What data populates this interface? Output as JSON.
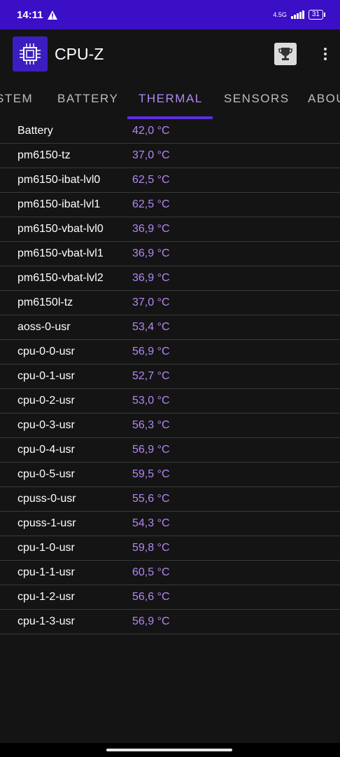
{
  "status_bar": {
    "time": "14:11",
    "alert_icon": "warning-triangle-icon",
    "network": "4.5G",
    "battery": "31"
  },
  "app_bar": {
    "title": "CPU-Z",
    "logo_icon": "cpu-chip-icon",
    "trophy_icon": "trophy-icon",
    "menu_icon": "more-vert-icon"
  },
  "tabs": [
    "STEM",
    "BATTERY",
    "THERMAL",
    "SENSORS",
    "ABOU"
  ],
  "active_tab": "THERMAL",
  "thermal": [
    {
      "name": "Battery",
      "value": "42,0 °C"
    },
    {
      "name": "pm6150-tz",
      "value": "37,0 °C"
    },
    {
      "name": "pm6150-ibat-lvl0",
      "value": "62,5 °C"
    },
    {
      "name": "pm6150-ibat-lvl1",
      "value": "62,5 °C"
    },
    {
      "name": "pm6150-vbat-lvl0",
      "value": "36,9 °C"
    },
    {
      "name": "pm6150-vbat-lvl1",
      "value": "36,9 °C"
    },
    {
      "name": "pm6150-vbat-lvl2",
      "value": "36,9 °C"
    },
    {
      "name": "pm6150l-tz",
      "value": "37,0 °C"
    },
    {
      "name": "aoss-0-usr",
      "value": "53,4 °C"
    },
    {
      "name": "cpu-0-0-usr",
      "value": "56,9 °C"
    },
    {
      "name": "cpu-0-1-usr",
      "value": "52,7 °C"
    },
    {
      "name": "cpu-0-2-usr",
      "value": "53,0 °C"
    },
    {
      "name": "cpu-0-3-usr",
      "value": "56,3 °C"
    },
    {
      "name": "cpu-0-4-usr",
      "value": "56,9 °C"
    },
    {
      "name": "cpu-0-5-usr",
      "value": "59,5 °C"
    },
    {
      "name": "cpuss-0-usr",
      "value": "55,6 °C"
    },
    {
      "name": "cpuss-1-usr",
      "value": "54,3 °C"
    },
    {
      "name": "cpu-1-0-usr",
      "value": "59,8 °C"
    },
    {
      "name": "cpu-1-1-usr",
      "value": "60,5 °C"
    },
    {
      "name": "cpu-1-2-usr",
      "value": "56,6 °C"
    },
    {
      "name": "cpu-1-3-usr",
      "value": "56,9 °C"
    }
  ],
  "colors": {
    "status_bar": "#3b0fc5",
    "accent": "#b287f5",
    "indicator": "#5a2ee0",
    "background": "#141414"
  }
}
